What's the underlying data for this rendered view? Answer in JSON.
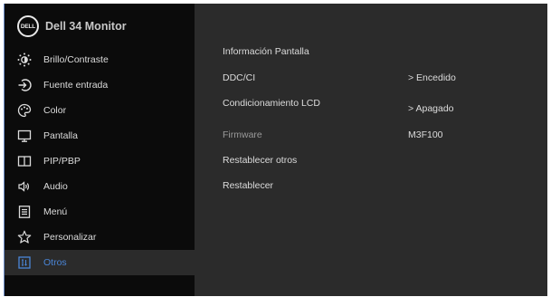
{
  "header": {
    "logo_text": "DELL",
    "monitor_name": "Dell  34 Monitor"
  },
  "menu": {
    "items": [
      {
        "label": "Brillo/Contraste",
        "icon": "brightness-icon"
      },
      {
        "label": "Fuente entrada",
        "icon": "input-source-icon"
      },
      {
        "label": "Color",
        "icon": "color-palette-icon"
      },
      {
        "label": "Pantalla",
        "icon": "display-icon"
      },
      {
        "label": "PIP/PBP",
        "icon": "pip-pbp-icon"
      },
      {
        "label": "Audio",
        "icon": "speaker-icon"
      },
      {
        "label": "Menú",
        "icon": "menu-list-icon"
      },
      {
        "label": "Personalizar",
        "icon": "star-icon"
      },
      {
        "label": "Otros",
        "icon": "others-icon"
      }
    ],
    "selected": "Otros"
  },
  "submenu": {
    "info_pantalla": "Información Pantalla",
    "ddc_ci": {
      "label": "DDC/CI",
      "value": "> Encedido"
    },
    "lcd_conditioning": {
      "label": "Condicionamiento LCD",
      "value": "> Apagado"
    },
    "firmware": {
      "label": "Firmware",
      "value": "M3F100"
    },
    "reset_others": "Restablecer otros",
    "reset": "Restablecer"
  },
  "colors": {
    "accent": "#4a86d8",
    "sidebar_bg": "#0b0b0b",
    "panel_bg": "#2b2b2b"
  }
}
